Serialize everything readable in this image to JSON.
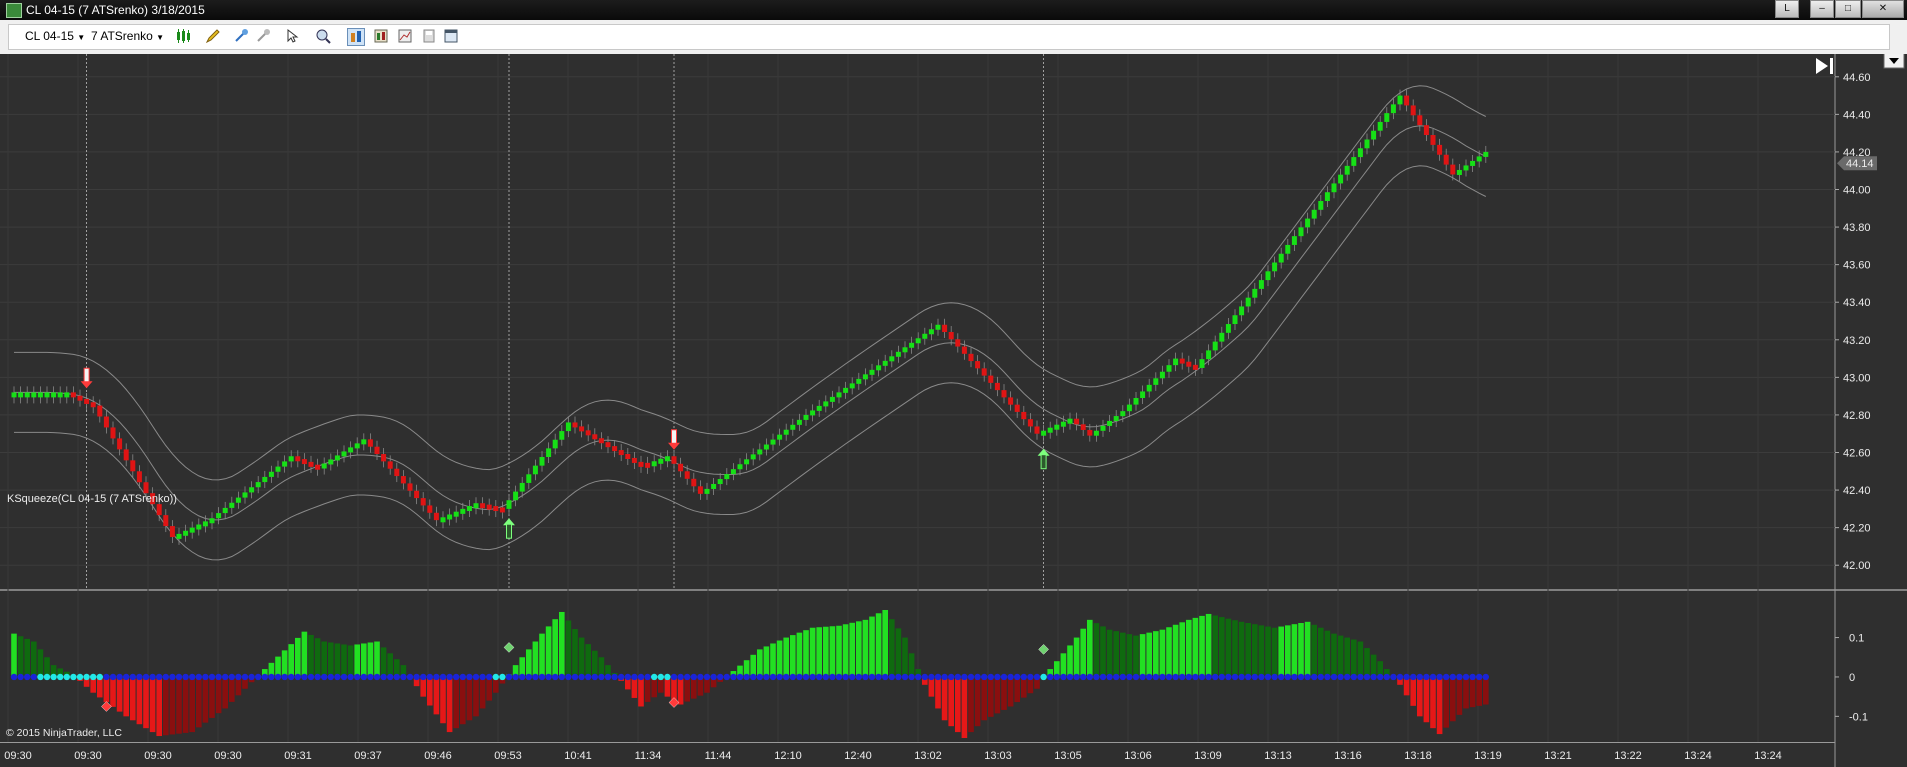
{
  "window": {
    "title": "CL 04-15 (7 ATSrenko)  3/18/2015",
    "buttons": [
      "L",
      "–",
      "□",
      "✕"
    ]
  },
  "toolbar": {
    "instrument": "CL 04-15",
    "period": "7 ATSrenko",
    "icons": [
      "candlestick-style-icon",
      "pencil-draw-icon",
      "add-indicator-icon",
      "strategy-icon",
      "cursor-pointer-icon",
      "zoom-icon",
      "data-box-icon",
      "properties-icon",
      "chart-template-icon",
      "save-icon",
      "window-icon"
    ]
  },
  "chart_data": [
    {
      "type": "renko",
      "title": "",
      "instrument": "CL 04-15 (7 ATSrenko)",
      "ylim": [
        41.9,
        44.7
      ],
      "y_ticks": [
        "44.60",
        "44.40",
        "44.20",
        "44.00",
        "43.80",
        "43.60",
        "43.40",
        "43.20",
        "43.00",
        "42.80",
        "42.60",
        "42.40",
        "42.20",
        "42.00"
      ],
      "last_price": "44.14",
      "x_ticks": [
        "09:30",
        "09:30",
        "09:30",
        "09:30",
        "09:31",
        "09:37",
        "09:46",
        "09:53",
        "10:41",
        "11:34",
        "11:44",
        "12:10",
        "12:40",
        "13:02",
        "13:03",
        "13:05",
        "13:06",
        "13:09",
        "13:13",
        "13:16",
        "13:18",
        "13:19",
        "13:21",
        "13:22",
        "13:24",
        "13:24"
      ],
      "close_path": [
        {
          "i": 0,
          "v": 42.92
        },
        {
          "i": 8,
          "v": 42.92
        },
        {
          "i": 12,
          "v": 42.85
        },
        {
          "i": 24,
          "v": 42.15
        },
        {
          "i": 30,
          "v": 42.25
        },
        {
          "i": 42,
          "v": 42.58
        },
        {
          "i": 46,
          "v": 42.52
        },
        {
          "i": 53,
          "v": 42.67
        },
        {
          "i": 64,
          "v": 42.24
        },
        {
          "i": 70,
          "v": 42.33
        },
        {
          "i": 74,
          "v": 42.3
        },
        {
          "i": 84,
          "v": 42.76
        },
        {
          "i": 94,
          "v": 42.55
        },
        {
          "i": 96,
          "v": 42.54
        },
        {
          "i": 99,
          "v": 42.58
        },
        {
          "i": 104,
          "v": 42.38
        },
        {
          "i": 120,
          "v": 42.8
        },
        {
          "i": 140,
          "v": 43.28
        },
        {
          "i": 155,
          "v": 42.7
        },
        {
          "i": 160,
          "v": 42.78
        },
        {
          "i": 163,
          "v": 42.69
        },
        {
          "i": 168,
          "v": 42.82
        },
        {
          "i": 176,
          "v": 43.1
        },
        {
          "i": 179,
          "v": 43.05
        },
        {
          "i": 210,
          "v": 44.5
        },
        {
          "i": 218,
          "v": 44.08
        },
        {
          "i": 223,
          "v": 44.2
        }
      ],
      "bar_colors": {
        "up": "#16e016",
        "down": "#e01414"
      },
      "bands_color": "#8a8a8a",
      "signals": [
        {
          "i": 11,
          "direction": "down",
          "color": "#ff3b3b"
        },
        {
          "i": 75,
          "direction": "up",
          "color": "#7dff7d"
        },
        {
          "i": 100,
          "direction": "down",
          "color": "#ff3b3b"
        },
        {
          "i": 156,
          "direction": "up",
          "color": "#7dff7d"
        }
      ],
      "vertical_markers_i": [
        11,
        75,
        100,
        156
      ]
    },
    {
      "type": "bar",
      "title": "KSqueeze(CL 04-15 (7 ATSrenko))",
      "ylim": [
        -0.155,
        0.17
      ],
      "y_ticks": [
        "0.1",
        "0",
        "-0.1"
      ],
      "momentum_path": [
        {
          "i": 0,
          "v": 0.11
        },
        {
          "i": 3,
          "v": 0.09
        },
        {
          "i": 6,
          "v": 0.03
        },
        {
          "i": 9,
          "v": 0.005
        },
        {
          "i": 12,
          "v": -0.04
        },
        {
          "i": 17,
          "v": -0.1
        },
        {
          "i": 22,
          "v": -0.15
        },
        {
          "i": 27,
          "v": -0.14
        },
        {
          "i": 32,
          "v": -0.08
        },
        {
          "i": 38,
          "v": 0.02
        },
        {
          "i": 44,
          "v": 0.115
        },
        {
          "i": 47,
          "v": 0.09
        },
        {
          "i": 51,
          "v": 0.08
        },
        {
          "i": 55,
          "v": 0.09
        },
        {
          "i": 59,
          "v": 0.03
        },
        {
          "i": 62,
          "v": -0.05
        },
        {
          "i": 66,
          "v": -0.14
        },
        {
          "i": 70,
          "v": -0.1
        },
        {
          "i": 73,
          "v": -0.04
        },
        {
          "i": 76,
          "v": 0.03
        },
        {
          "i": 80,
          "v": 0.11
        },
        {
          "i": 83,
          "v": 0.165
        },
        {
          "i": 86,
          "v": 0.1
        },
        {
          "i": 89,
          "v": 0.05
        },
        {
          "i": 92,
          "v": -0.01
        },
        {
          "i": 95,
          "v": -0.075
        },
        {
          "i": 98,
          "v": -0.04
        },
        {
          "i": 101,
          "v": -0.07
        },
        {
          "i": 105,
          "v": -0.04
        },
        {
          "i": 109,
          "v": 0.015
        },
        {
          "i": 113,
          "v": 0.07
        },
        {
          "i": 117,
          "v": 0.1
        },
        {
          "i": 121,
          "v": 0.125
        },
        {
          "i": 125,
          "v": 0.13
        },
        {
          "i": 129,
          "v": 0.145
        },
        {
          "i": 132,
          "v": 0.17
        },
        {
          "i": 135,
          "v": 0.1
        },
        {
          "i": 138,
          "v": -0.02
        },
        {
          "i": 141,
          "v": -0.11
        },
        {
          "i": 144,
          "v": -0.155
        },
        {
          "i": 147,
          "v": -0.11
        },
        {
          "i": 151,
          "v": -0.075
        },
        {
          "i": 155,
          "v": -0.03
        },
        {
          "i": 157,
          "v": 0.02
        },
        {
          "i": 161,
          "v": 0.1
        },
        {
          "i": 163,
          "v": 0.145
        },
        {
          "i": 166,
          "v": 0.12
        },
        {
          "i": 170,
          "v": 0.105
        },
        {
          "i": 174,
          "v": 0.12
        },
        {
          "i": 178,
          "v": 0.145
        },
        {
          "i": 181,
          "v": 0.16
        },
        {
          "i": 186,
          "v": 0.14
        },
        {
          "i": 191,
          "v": 0.125
        },
        {
          "i": 196,
          "v": 0.14
        },
        {
          "i": 200,
          "v": 0.11
        },
        {
          "i": 204,
          "v": 0.09
        },
        {
          "i": 207,
          "v": 0.04
        },
        {
          "i": 210,
          "v": -0.02
        },
        {
          "i": 213,
          "v": -0.1
        },
        {
          "i": 216,
          "v": -0.145
        },
        {
          "i": 220,
          "v": -0.08
        },
        {
          "i": 223,
          "v": -0.07
        }
      ],
      "squeeze_on_ranges": [
        [
          4,
          13
        ],
        [
          73,
          74
        ],
        [
          97,
          99
        ],
        [
          156,
          156
        ]
      ],
      "squeeze_colors": {
        "on": "#22e8e8",
        "off": "#1a24d8"
      },
      "bar_colors": {
        "rising_pos": "#22e022",
        "falling_pos": "#0f6a0f",
        "falling_neg": "#e61818",
        "rising_neg": "#8a0f0f"
      },
      "diamonds": [
        {
          "i": 14,
          "v": -0.075,
          "color": "#ff3b3b"
        },
        {
          "i": 75,
          "v": 0.075,
          "color": "#6fd26f"
        },
        {
          "i": 100,
          "v": -0.065,
          "color": "#ff3b3b"
        },
        {
          "i": 156,
          "v": 0.07,
          "color": "#6fd26f"
        }
      ]
    }
  ],
  "footer": {
    "copyright": "© 2015 NinjaTrader, LLC"
  }
}
